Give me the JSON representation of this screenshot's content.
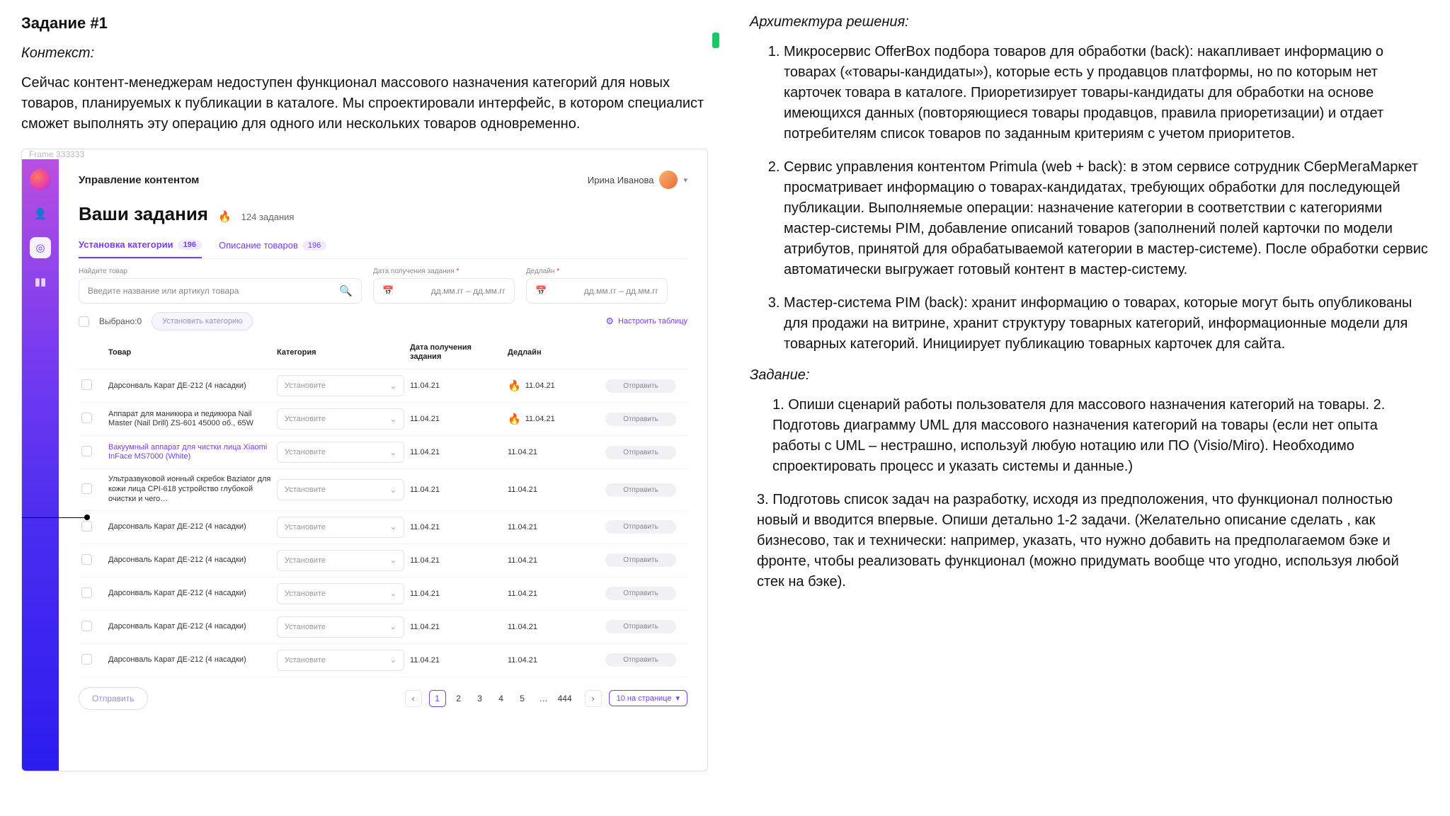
{
  "left": {
    "task_title": "Задание #1",
    "context_label": "Контекст:",
    "context_text": "Сейчас контент-менеджерам недоступен функционал массового назначения категорий для новых товаров, планируемых к публикации в каталоге. Мы спроектировали интерфейс, в котором специалист сможет выполнять эту операцию для одного или нескольких товаров одновременно."
  },
  "mock": {
    "frame_label": "Frame 333333",
    "topbar_title": "Управление контентом",
    "user_name": "Ирина Иванова",
    "page_title": "Ваши задания",
    "task_count": "124 задания",
    "tabs": [
      {
        "label": "Установка категории",
        "count": "196",
        "active": true
      },
      {
        "label": "Описание товаров",
        "count": "196",
        "active": false
      }
    ],
    "filters": {
      "search_label": "Найдите товар",
      "search_placeholder": "Введите название или артикул товара",
      "date1_label": "Дата получения задания",
      "date2_label": "Дедлайн",
      "date_placeholder": "дд.мм.гг – дд.мм.гг"
    },
    "toolbar": {
      "selected_label": "Выбрано:0",
      "set_category_label": "Установить категорию",
      "table_settings_label": "Настроить таблицу"
    },
    "thead": {
      "c1": "Товар",
      "c2": "Категория",
      "c3": "Дата получения задания",
      "c4": "Дедлайн"
    },
    "category_placeholder": "Установите",
    "send_label": "Отправить",
    "rows": [
      {
        "name": "Дарсонваль Карат ДЕ-212 (4 насадки)",
        "received": "11.04.21",
        "deadline": "11.04.21",
        "hot": true,
        "highlight": false
      },
      {
        "name": "Аппарат для маникюра и педикюра Nail Master (Nail Drill) ZS-601 45000 об., 65W",
        "received": "11.04.21",
        "deadline": "11.04.21",
        "hot": true,
        "highlight": false
      },
      {
        "name": "Вакуумный аппарат для чистки лица Xiaomi InFace MS7000 (White)",
        "received": "11.04.21",
        "deadline": "11.04.21",
        "hot": false,
        "highlight": true
      },
      {
        "name": "Ультразвуковой ионный скребок Baziator для кожи лица CPI-618 устройство глубокой очистки и чего…",
        "received": "11.04.21",
        "deadline": "11.04.21",
        "hot": false,
        "highlight": false
      },
      {
        "name": "Дарсонваль Карат ДЕ-212 (4 насадки)",
        "received": "11.04.21",
        "deadline": "11.04.21",
        "hot": false,
        "highlight": false
      },
      {
        "name": "Дарсонваль Карат ДЕ-212 (4 насадки)",
        "received": "11.04.21",
        "deadline": "11.04.21",
        "hot": false,
        "highlight": false
      },
      {
        "name": "Дарсонваль Карат ДЕ-212 (4 насадки)",
        "received": "11.04.21",
        "deadline": "11.04.21",
        "hot": false,
        "highlight": false
      },
      {
        "name": "Дарсонваль Карат ДЕ-212 (4 насадки)",
        "received": "11.04.21",
        "deadline": "11.04.21",
        "hot": false,
        "highlight": false
      },
      {
        "name": "Дарсонваль Карат ДЕ-212 (4 насадки)",
        "received": "11.04.21",
        "deadline": "11.04.21",
        "hot": false,
        "highlight": false
      }
    ],
    "footer": {
      "submit_label": "Отправить",
      "pages": [
        "1",
        "2",
        "3",
        "4",
        "5",
        "…",
        "444"
      ],
      "per_page_label": "10 на странице"
    }
  },
  "right": {
    "arch_label": "Архитектура решения:",
    "arch_items": [
      "Микросервис OfferBox подбора товаров для обработки (back): накапливает информацию о товарах («товары-кандидаты»), которые есть у продавцов платформы, но по которым нет карточек товара в каталоге. Приоретизирует товары-кандидаты для обработки на основе имеющихся данных (повторяющиеся товары продавцов, правила приоретизации) и отдает потребителям список товаров по заданным критериям с учетом приоритетов.",
      "Сервис управления контентом Primula (web + back): в этом сервисе сотрудник СберМегаМаркет просматривает информацию о товарах-кандидатах, требующих обработки для последующей публикации. Выполняемые операции: назначение категории в соответствии с категориями мастер-системы PIM, добавление описаний товаров (заполнений полей карточки по модели атрибутов, принятой для обрабатываемой категории в мастер-системе). После обработки сервис автоматически выгружает готовый контент в мастер-систему.",
      "Мастер-система PIM (back): хранит информацию о товарах, которые могут быть опубликованы для продажи на витрине, хранит структуру товарных категорий, информационные модели для товарных категорий. Инициирует публикацию товарных карточек для сайта."
    ],
    "task_label": "Задание:",
    "task_para1": "1. Опиши сценарий работы пользователя для массового назначения категорий на товары.  2. Подготовь диаграмму UML для массового назначения категорий на товары (если нет опыта работы с UML – нестрашно, используй любую нотацию или ПО (Visio/Miro). Необходимо спроектировать процесс и указать системы и данные.)",
    "task_para2": "3. Подготовь список задач на разработку, исходя из предположения, что функционал полностью новый и вводится впервые. Опиши детально 1-2 задачи. (Желательно описание сделать , как бизнесово, так и технически: например, указать, что нужно добавить на предполагаемом бэке и фронте, чтобы реализовать функционал (можно придумать вообще что угодно, используя любой стек на бэке)."
  }
}
